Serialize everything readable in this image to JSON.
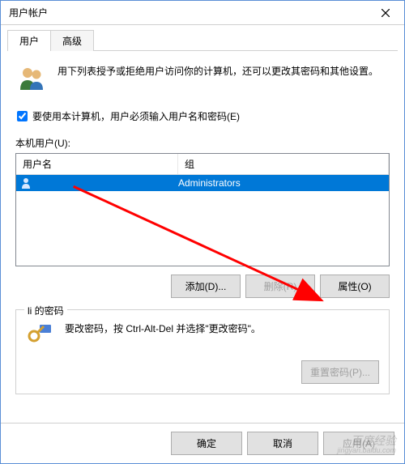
{
  "window": {
    "title": "用户帐户"
  },
  "tabs": {
    "user": "用户",
    "advanced": "高级"
  },
  "intro": "用下列表授予或拒绝用户访问你的计算机，还可以更改其密码和其他设置。",
  "checkbox": {
    "label": "要使用本计算机，用户必须输入用户名和密码(E)",
    "checked": true
  },
  "list": {
    "caption": "本机用户(U):",
    "headers": {
      "user": "用户名",
      "group": "组"
    },
    "rows": [
      {
        "user": "",
        "group": "Administrators",
        "selected": true
      }
    ]
  },
  "buttons": {
    "add": "添加(D)...",
    "remove": "删除(R)",
    "properties": "属性(O)"
  },
  "password": {
    "legend": "li 的密码",
    "text": "要改密码，按 Ctrl-Alt-Del 并选择\"更改密码\"。",
    "reset": "重置密码(P)..."
  },
  "bottom": {
    "ok": "确定",
    "cancel": "取消",
    "apply": "应用(A)"
  },
  "watermark": {
    "main": "Bai",
    "du": "百度经验",
    "sub": "jingyan.baidu.com"
  }
}
